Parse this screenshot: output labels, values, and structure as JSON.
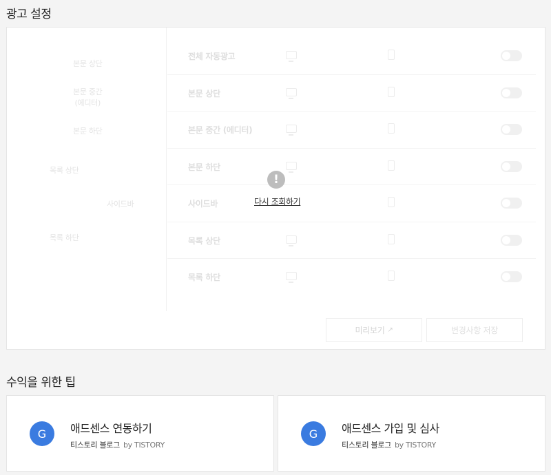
{
  "ad_settings": {
    "title": "광고 설정",
    "preview_labels": {
      "top": "본문 상단",
      "middle_line1": "본문 중간",
      "middle_line2": "(에디터)",
      "bottom": "본문 하단",
      "list_top": "목록 상단",
      "sidebar": "사이드바",
      "list_bottom": "목록 하단"
    },
    "rows": [
      {
        "label": "전체 자동광고"
      },
      {
        "label": "본문 상단"
      },
      {
        "label": "본문 중간 (에디터)"
      },
      {
        "label": "본문 하단"
      },
      {
        "label": "사이드바"
      },
      {
        "label": "목록 상단"
      },
      {
        "label": "목록 하단"
      }
    ],
    "preview_button": "미리보기",
    "save_button": "변경사항 저장",
    "alert_symbol": "!",
    "retry_link": "다시 조회하기"
  },
  "tips": {
    "title": "수익을 위한 팁",
    "cards": [
      {
        "avatar": "G",
        "title": "애드센스 연동하기",
        "source": "티스토리 블로그",
        "by": "by TISTORY"
      },
      {
        "avatar": "G",
        "title": "애드센스 가입 및 심사",
        "source": "티스토리 블로그",
        "by": "by TISTORY"
      }
    ]
  },
  "colors": {
    "avatar_bg": "#3a7be0",
    "page_bg": "#f4f4f4"
  }
}
